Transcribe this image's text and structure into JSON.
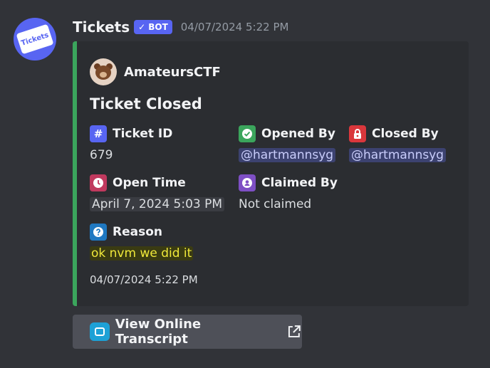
{
  "message": {
    "username": "Tickets",
    "bot_badge": "BOT",
    "timestamp": "04/07/2024 5:22 PM",
    "avatar_text": "Tickets"
  },
  "embed": {
    "accent_color": "#3ba55c",
    "author": "AmateursCTF",
    "title": "Ticket Closed",
    "fields": {
      "ticket_id": {
        "name": "Ticket ID",
        "value": "679",
        "icon": "hash-icon",
        "color": "#5865f2"
      },
      "opened_by": {
        "name": "Opened By",
        "value": "@hartmannsyg",
        "icon": "check-circle-icon",
        "color": "#3ba55c"
      },
      "closed_by": {
        "name": "Closed By",
        "value": "@hartmannsyg",
        "icon": "lock-icon",
        "color": "#da373c"
      },
      "open_time": {
        "name": "Open Time",
        "value": "April 7, 2024 5:03 PM",
        "icon": "clock-icon",
        "color": "#c0395e"
      },
      "claimed_by": {
        "name": "Claimed By",
        "value": "Not claimed",
        "icon": "user-badge-icon",
        "color": "#7e4fc4"
      },
      "reason": {
        "name": "Reason",
        "value": "ok nvm we did it",
        "icon": "question-icon",
        "color": "#1f78c1"
      }
    },
    "footer": "04/07/2024 5:22 PM"
  },
  "button": {
    "label": "View Online Transcript",
    "icon": "transcript-icon",
    "external_icon": "external-link-icon"
  }
}
